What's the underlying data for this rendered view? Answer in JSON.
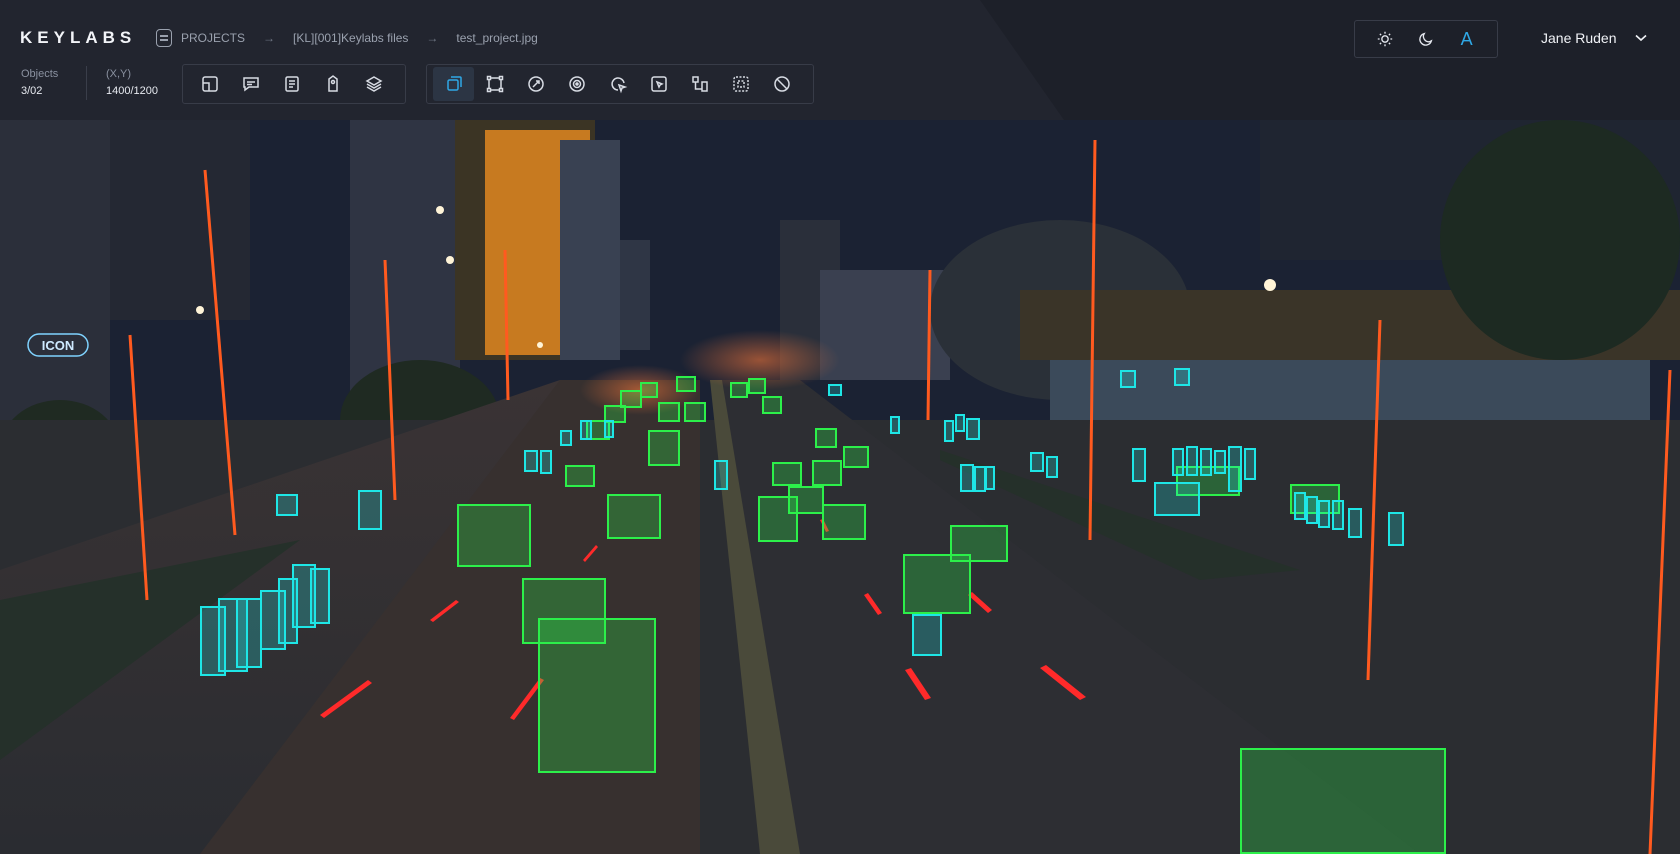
{
  "app": {
    "logo": "KEYLABS"
  },
  "breadcrumb": {
    "root": "PROJECTS",
    "folder": "[KL][001]Keylabs files",
    "file": "test_project.jpg",
    "separator": "→"
  },
  "stats": {
    "objects_label": "Objects",
    "objects_value": "3/02",
    "xy_label": "(X,Y)",
    "xy_value": "1400/1200"
  },
  "toolgroup_left": [
    "page-icon",
    "comment-icon",
    "list-icon",
    "tag-icon",
    "layers-icon"
  ],
  "toolgroup_right": [
    "bounding-box-icon",
    "polygon-icon",
    "magic-wand-icon",
    "segmentation-icon",
    "rotate-select-icon",
    "click-select-icon",
    "keypoint-icon",
    "brush-grid-icon",
    "eraser-icon"
  ],
  "theme": {
    "active": "A",
    "options": [
      "light-mode-icon",
      "dark-mode-icon",
      "auto-mode-icon"
    ]
  },
  "user": {
    "name": "Jane Ruden"
  },
  "colors": {
    "accent": "#2fa8e6",
    "vehicle_box": "#2cf04a",
    "person_box": "#1ee6e6",
    "pole": "#ff5a1f"
  },
  "image": {
    "sign_text": "ICON"
  }
}
